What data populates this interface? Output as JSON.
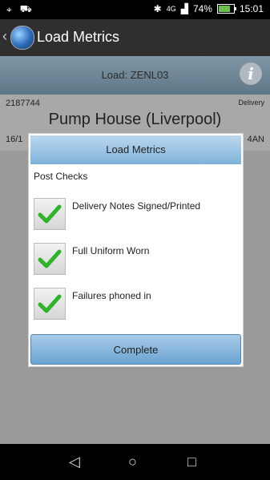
{
  "status_bar": {
    "battery": "74%",
    "time": "15:01",
    "network": "4G"
  },
  "app_bar": {
    "back_glyph": "‹",
    "title": "Load Metrics"
  },
  "load_header": {
    "label": "Load: ZENL03",
    "info_glyph": "i"
  },
  "load_item": {
    "id": "2187744",
    "type": "Delivery",
    "name": "Pump House (Liverpool)",
    "date": "16/1",
    "postcode_fragment": "4AN"
  },
  "dialog": {
    "title": "Load Metrics",
    "section_label": "Post Checks",
    "checks": [
      {
        "label": "Delivery Notes Signed/Printed",
        "checked": true
      },
      {
        "label": "Full Uniform Worn",
        "checked": true
      },
      {
        "label": "Failures phoned in",
        "checked": true
      }
    ],
    "complete_label": "Complete"
  },
  "colors": {
    "check_green": "#2db52a",
    "dialog_header": "#8fbde2",
    "button_blue": "#6aa3d2"
  }
}
